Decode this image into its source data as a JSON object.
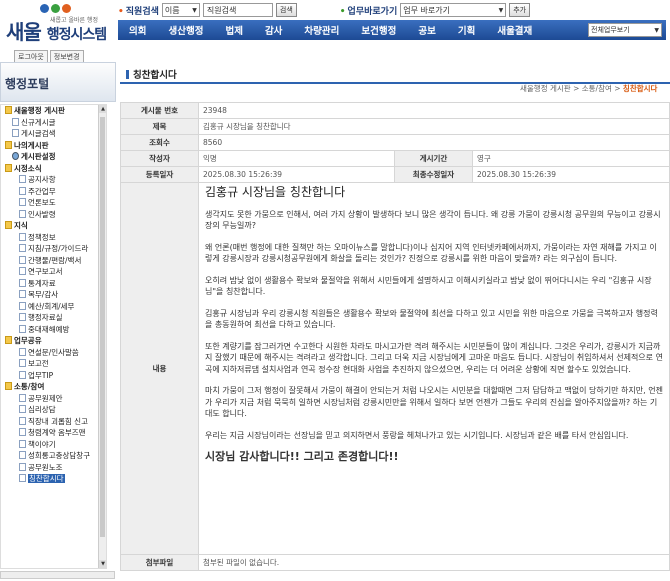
{
  "header": {
    "logo_main": "새울",
    "logo_sub": "행정시스템",
    "logo_small": "새롭고 올바른 행정",
    "search_label": "직원검색",
    "search_select": "이름",
    "search_value": "직원검색",
    "search_button": "검색",
    "quick_label": "업무바로가기",
    "quick_select": "업무 바로가기",
    "quick_button": "추가"
  },
  "nav": {
    "items": [
      "의회",
      "생산행정",
      "법제",
      "감사",
      "차량관리",
      "보건행정",
      "공보",
      "기획",
      "새울결재"
    ],
    "right_select": "전체업무보기"
  },
  "login": {
    "logout": "로그아웃",
    "info": "정보변경"
  },
  "sidebar": {
    "title": "행정포털",
    "items": [
      {
        "label": "새울행정 게시판",
        "icon": "folder",
        "indent": 0,
        "bold": true
      },
      {
        "label": "신규게시글",
        "icon": "doc",
        "indent": 1
      },
      {
        "label": "게시글검색",
        "icon": "doc",
        "indent": 1
      },
      {
        "label": "나의게시판",
        "icon": "folder",
        "indent": 0,
        "bold": true
      },
      {
        "label": "게시판설정",
        "icon": "globe",
        "indent": 1,
        "bold": true
      },
      {
        "label": "시정소식",
        "icon": "folder",
        "indent": 0,
        "bold": true
      },
      {
        "label": "공지사항",
        "icon": "doc",
        "indent": 2
      },
      {
        "label": "주간업무",
        "icon": "doc",
        "indent": 2
      },
      {
        "label": "언론보도",
        "icon": "doc",
        "indent": 2
      },
      {
        "label": "인사발령",
        "icon": "doc",
        "indent": 2
      },
      {
        "label": "지식",
        "icon": "folder",
        "indent": 0,
        "bold": true
      },
      {
        "label": "정책정보",
        "icon": "doc",
        "indent": 2
      },
      {
        "label": "지침/규정/가이드라",
        "icon": "doc",
        "indent": 2
      },
      {
        "label": "간행물/편람/백서",
        "icon": "doc",
        "indent": 2
      },
      {
        "label": "연구보고서",
        "icon": "doc",
        "indent": 2
      },
      {
        "label": "통계자료",
        "icon": "doc",
        "indent": 2
      },
      {
        "label": "복무/감사",
        "icon": "doc",
        "indent": 2
      },
      {
        "label": "예산/회계/세무",
        "icon": "doc",
        "indent": 2
      },
      {
        "label": "행정자료실",
        "icon": "doc",
        "indent": 2
      },
      {
        "label": "중대재해예방",
        "icon": "doc",
        "indent": 2
      },
      {
        "label": "업무공유",
        "icon": "folder",
        "indent": 0,
        "bold": true
      },
      {
        "label": "연설문/인사말씀",
        "icon": "doc",
        "indent": 2
      },
      {
        "label": "보고전",
        "icon": "doc",
        "indent": 2
      },
      {
        "label": "업무TIP",
        "icon": "doc",
        "indent": 2
      },
      {
        "label": "소통/참여",
        "icon": "folder",
        "indent": 0,
        "bold": true
      },
      {
        "label": "공무원제안",
        "icon": "doc",
        "indent": 2
      },
      {
        "label": "심리상담",
        "icon": "doc",
        "indent": 2
      },
      {
        "label": "직장내 괴롭힘 신고",
        "icon": "doc",
        "indent": 2
      },
      {
        "label": "청렴계약 옴부즈맨",
        "icon": "doc",
        "indent": 2
      },
      {
        "label": "책이야기",
        "icon": "doc",
        "indent": 2
      },
      {
        "label": "성희롱고충상담창구",
        "icon": "doc",
        "indent": 2
      },
      {
        "label": "공무원노조",
        "icon": "doc",
        "indent": 2
      },
      {
        "label": "칭찬합시다",
        "icon": "doc",
        "indent": 2,
        "selected": true
      }
    ]
  },
  "main": {
    "page_title": "칭찬합시다",
    "breadcrumb": {
      "path": "새울행정 게시판 > 소통/참여 > ",
      "current": "칭찬합시다"
    },
    "labels": {
      "post_no": "게시물 번호",
      "title": "제목",
      "views": "조회수",
      "author": "작성자",
      "period": "게시기간",
      "created": "등록일자",
      "modified": "최종수정일자",
      "content": "내용",
      "attachment": "첨부파일"
    },
    "values": {
      "post_no": "23948",
      "title": "김홍규 시장님을 칭찬합니다",
      "views": "8560",
      "author": "익명",
      "period": "영구",
      "created": "2025.08.30 15:26:39",
      "modified": "2025.08.30 15:26:39",
      "attachment": "첨부된 파일이 없습니다."
    },
    "content": {
      "heading": "김홍규 시장님을 칭찬합니다",
      "paragraphs": [
        "생각지도 못한 가뭄으로 인해서, 여러 가지 상황이 발생하다 보니 많은 생각이 듭니다. 왜 강릉 가뭄이 강릉시청 공무원의 무능이고 강릉시장의 무능일까?",
        "왜 언론(매번 행정에 대한 질책만 하는 오마이뉴스를 말합니다)이나 심지어 지역 인터넷카페에서까지, 가뭄이라는 자연 재해를 가지고 이렇게 강릉시장과 강릉시청공무원에게 화살을 돌리는 것인가? 진정으로 강릉시를 위한 마음이 맞을까? 라는 의구심이 듭니다.",
        "오히려 밤낮 없이 생활용수 확보와 물절약을 위해서 시민들에게 설명하시고 이해시키실라고 밤낮 없이 뛰어다니시는 우리 \"김홍규 시장님\"을 칭찬합니다.",
        "김홍규 시장님과 우리 강릉시청 직원들은 생활용수 확보와 물절약에 최선을 다하고 있고 시민을 위한 마음으로 가뭄을 극복하고자 행정력을 총동원하여 최선을 다하고 있습니다.",
        "또한 계량기를 잠그러가면 수고한다 시원한 차라도 마시고가란 격려 해주시는 시민분들이 많이 계십니다. 그것은 우리가, 강릉시가 지금까지 잘했기 때문에 해주시는 격려라고 생각합니다. 그리고 더욱 지금 시장님에게 고마운 마음도 듭니다. 시장님이 취임하셔서 선제적으로 연곡에 지하저류댐 설치사업과 연곡 정수장 현대화 사업을 추진하지 않으셨으면, 우리는 더 어려운 상황에 직면 할수도 있었습니다.",
        "마치 가뭄이 그저 행정이 잘못해서 가뭄이 해결이 안되는거 처럼 나오시는 시민분을 대할때면 그저 답답하고 맥없이 당하기만 하지만, 언젠가 우리가 지금 처럼 묵묵히 일하면 시장님처럼 강릉시민만을 위해서 일하다 보면 언젠가 그들도 우리의 진심을 알아주지않을까? 하는 기대도 합니다.",
        "우리는 지금 시장님이라는 선장님을 믿고 의지하면서 풍랑을 헤쳐나가고 있는 시기입니다. 시장님과 같은 배를 타서 안심입니다."
      ],
      "closing": "시장님 감사합니다!! 그리고 존경합니다!!"
    }
  },
  "colors": {
    "nav": "#1d4a94",
    "accent": "#d85a10",
    "header_bg": "#eeeeee"
  }
}
